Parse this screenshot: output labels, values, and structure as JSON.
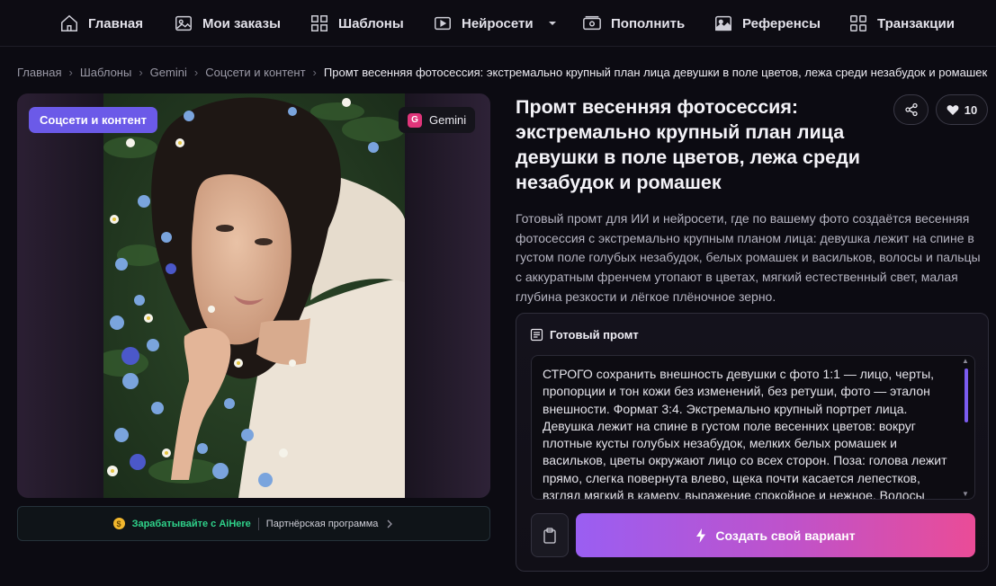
{
  "nav": {
    "items": [
      {
        "label": "Главная",
        "icon": "home-icon"
      },
      {
        "label": "Мои заказы",
        "icon": "image-icon"
      },
      {
        "label": "Шаблоны",
        "icon": "grid-icon"
      },
      {
        "label": "Нейросети",
        "icon": "play-icon"
      },
      {
        "label": "Пополнить",
        "icon": "wallet-icon"
      },
      {
        "label": "Референсы",
        "icon": "picture-icon"
      },
      {
        "label": "Транзакции",
        "icon": "squares-icon"
      }
    ]
  },
  "breadcrumb": {
    "items": [
      "Главная",
      "Шаблоны",
      "Gemini",
      "Соцсети и контент"
    ],
    "current": "Промт весенняя фотосессия: экстремально крупный план лица девушки в поле цветов, лежа среди незабудок и ромашек"
  },
  "card": {
    "category": "Соцсети и контент",
    "model_badge": "G",
    "model": "Gemini"
  },
  "partner": {
    "earn": "Зарабатывайте с AiHere",
    "program": "Партнёрская программа"
  },
  "detail": {
    "title": "Промт весенняя фотосессия: экстремально крупный план лица девушки в поле цветов, лежа среди незабудок и ромашек",
    "likes": "10",
    "description": "Готовый промт для ИИ и нейросети, где по вашему фото создаётся весенняя фотосессия с экстремально крупным планом лица: девушка лежит на спине в густом поле голубых незабудок, белых ромашек и васильков, волосы и пальцы с аккуратным френчем утопают в цветах, мягкий естественный свет, малая глубина резкости и лёгкое плёночное зерно."
  },
  "prompt": {
    "heading": "Готовый промт",
    "text": "СТРОГО сохранить внешность девушки с фото 1:1 — лицо, черты, пропорции и тон кожи без изменений, без ретуши, фото — эталон внешности. Формат 3:4. Экстремально крупный портрет лица. Девушка лежит на спине в густом поле весенних цветов: вокруг плотные кусты голубых незабудок, мелких белых ромашек и васильков, цветы окружают лицо со всех сторон. Поза: голова лежит прямо, слегка повернута влево, щека почти касается лепестков, взгляд мягкий в камеру, выражение спокойное и нежное. Волосы распущены",
    "create_label": "Создать свой вариант"
  },
  "colors": {
    "accent": "#6b5ae8",
    "gradient_start": "#9a5ef2",
    "gradient_end": "#ea4c97",
    "earn": "#2fd28a"
  }
}
